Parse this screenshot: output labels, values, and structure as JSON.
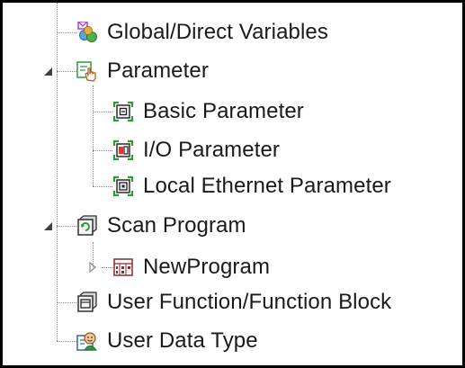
{
  "tree": {
    "items": [
      {
        "label": "Global/Direct Variables",
        "icon": "global-variables-icon"
      },
      {
        "label": "Parameter",
        "icon": "parameter-hand-icon",
        "expanded": true
      },
      {
        "label": "Basic Parameter",
        "icon": "basic-parameter-icon"
      },
      {
        "label": "I/O Parameter",
        "icon": "io-parameter-icon"
      },
      {
        "label": "Local Ethernet Parameter",
        "icon": "ethernet-parameter-icon"
      },
      {
        "label": "Scan Program",
        "icon": "scan-program-icon",
        "expanded": true
      },
      {
        "label": "NewProgram",
        "icon": "program-icon",
        "expanded": false
      },
      {
        "label": "User Function/Function Block",
        "icon": "function-block-icon"
      },
      {
        "label": "User Data Type",
        "icon": "user-data-type-icon"
      }
    ]
  },
  "colors": {
    "connector": "#8a8a8a",
    "text": "#1a1a1a",
    "parameter_accent": "#2a9d3a",
    "io_accent": "#d83a3a"
  }
}
